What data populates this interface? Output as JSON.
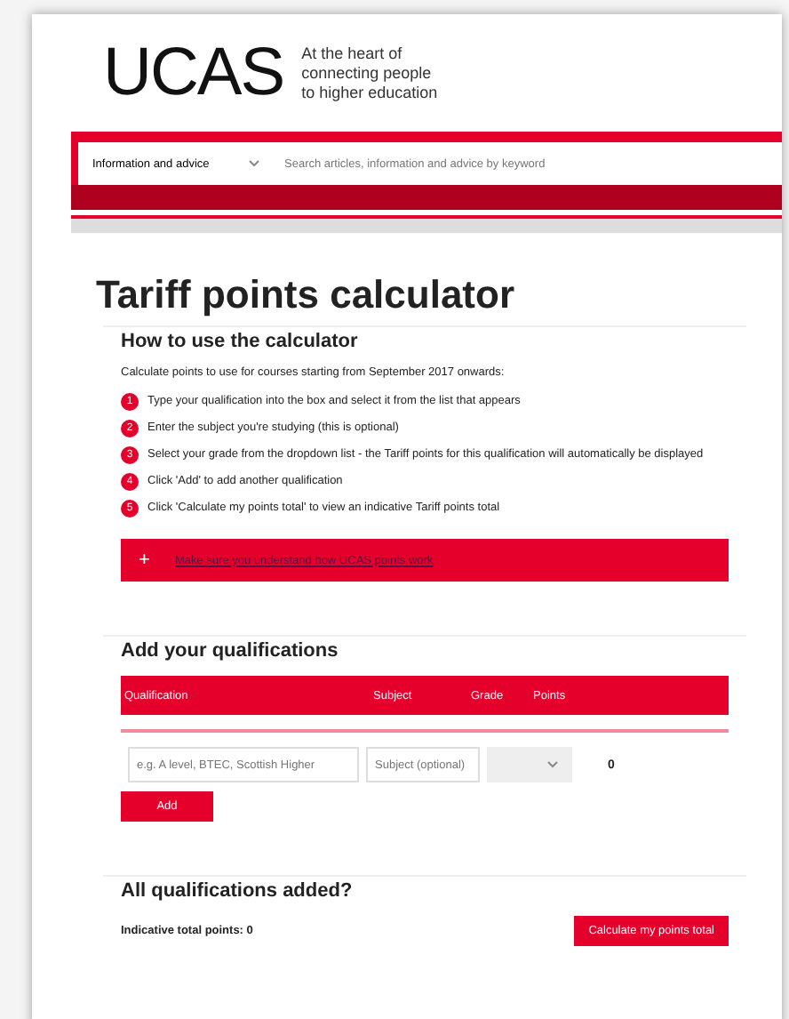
{
  "header": {
    "logo": "UCAS",
    "tagline": [
      "At the heart of",
      "connecting people",
      "to higher education"
    ]
  },
  "search": {
    "category": "Information and advice",
    "placeholder": "Search articles, information and advice by keyword"
  },
  "title": "Tariff points calculator",
  "how_to": {
    "heading": "How to use the calculator",
    "intro": "Calculate points to use for courses starting from September 2017 onwards:",
    "steps": [
      {
        "number": "1",
        "text": "Type your qualification into the box and select it from the list that appears"
      },
      {
        "number": "2",
        "text": "Enter the subject you're studying (this is optional)"
      },
      {
        "number": "3",
        "text": "Select your grade from the dropdown list - the Tariff points for this qualification will automatically be displayed"
      },
      {
        "number": "4",
        "text": "Click 'Add' to add another qualification"
      },
      {
        "number": "5",
        "text": "Click 'Calculate my points total' to view an indicative Tariff points total"
      }
    ],
    "banner": {
      "icon": "+",
      "link": "Make sure you understand how UCAS points work"
    }
  },
  "qualifications": {
    "heading": "Add your qualifications",
    "columns": [
      "Qualification",
      "Subject",
      "Grade",
      "Points"
    ],
    "row": {
      "qualification_placeholder": "e.g. A level, BTEC, Scottish Higher",
      "subject_placeholder": "Subject (optional)",
      "points": "0"
    },
    "add_button": "Add"
  },
  "summary": {
    "heading": "All qualifications added?",
    "total": "Indicative total points: 0",
    "button": "Calculate my points total"
  }
}
